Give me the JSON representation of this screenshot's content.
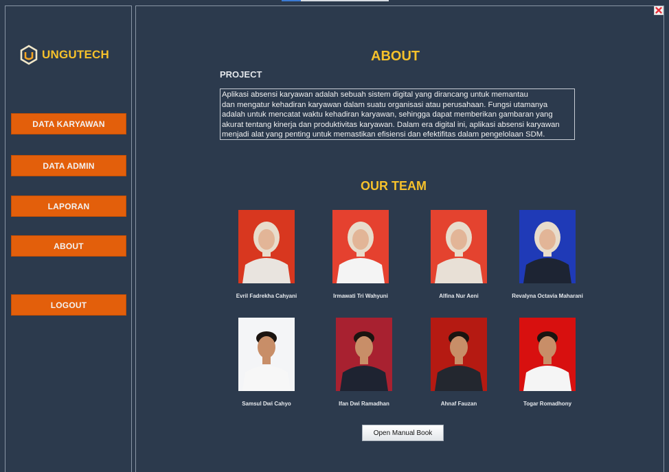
{
  "window": {
    "close_icon": "close-x-icon",
    "close_color": "#e8323c"
  },
  "sidebar": {
    "brand": {
      "name": "UNGUTECH",
      "logo_icon": "hexagon-u-logo-icon",
      "color": "#f6c12b"
    },
    "items": [
      {
        "label": "DATA KARYAWAN"
      },
      {
        "label": "DATA ADMIN"
      },
      {
        "label": "LAPORAN"
      },
      {
        "label": "ABOUT"
      },
      {
        "label": "LOGOUT"
      }
    ],
    "button_color": "#e35f0b"
  },
  "main": {
    "title": "ABOUT",
    "project_label": "PROJECT",
    "project_text": "Aplikasi absensi karyawan adalah sebuah sistem digital yang dirancang untuk memantau\ndan mengatur kehadiran karyawan dalam suatu organisasi atau perusahaan. Fungsi utamanya\nadalah untuk mencatat waktu kehadiran karyawan, sehingga dapat memberikan gambaran yang\nakurat tentang kinerja dan produktivitas karyawan. Dalam era digital ini, aplikasi absensi karyawan\nmenjadi alat yang penting untuk memastikan efisiensi dan efektifitas dalam pengelolaan SDM.",
    "team_title": "OUR TEAM",
    "team": [
      {
        "name": "Evril Fadrekha Cahyani",
        "photo_bg": "#d8371f"
      },
      {
        "name": "Irmawati Tri Wahyuni",
        "photo_bg": "#e5412f"
      },
      {
        "name": "Alfina Nur Aeni",
        "photo_bg": "#e4432f"
      },
      {
        "name": "Revalyna Octavia Maharani",
        "photo_bg": "#1f3ab7"
      },
      {
        "name": "Samsul Dwi Cahyo",
        "photo_bg": "#f4f5f7"
      },
      {
        "name": "Ifan Dwi Ramadhan",
        "photo_bg": "#a82130"
      },
      {
        "name": "Ahnaf Fauzan",
        "photo_bg": "#b51a12"
      },
      {
        "name": "Togar Romadhony",
        "photo_bg": "#d8100f"
      }
    ],
    "manual_button": "Open Manual Book"
  },
  "colors": {
    "background": "#2c3a4d",
    "accent": "#f6c12b"
  }
}
